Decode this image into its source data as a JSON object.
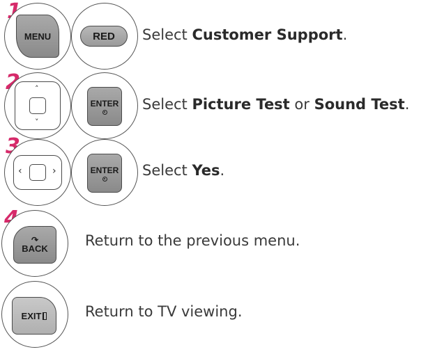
{
  "steps": [
    {
      "number": "1",
      "keys": [
        "MENU",
        "RED"
      ],
      "text_prefix": "Select ",
      "bold1": "Customer Support",
      "suffix": "."
    },
    {
      "number": "2",
      "keys": [
        "nav-up-down",
        "ENTER"
      ],
      "text_prefix": "Select ",
      "bold1": "Picture Test",
      "middle": " or ",
      "bold2": "Sound Test",
      "suffix": "."
    },
    {
      "number": "3",
      "keys": [
        "nav-left-right",
        "ENTER"
      ],
      "text_prefix": "Select ",
      "bold1": "Yes",
      "suffix": "."
    },
    {
      "number": "4",
      "keys": [
        "BACK"
      ],
      "text": "Return to the previous menu."
    },
    {
      "number": "",
      "keys": [
        "EXIT"
      ],
      "text": "Return to TV viewing."
    }
  ],
  "labels": {
    "menu": "MENU",
    "red": "RED",
    "enter": "ENTER",
    "back": "BACK",
    "exit": "EXIT"
  },
  "icons": {
    "up": "˄",
    "down": "˅",
    "left": "‹",
    "right": "›",
    "back_curve": "↷"
  },
  "colors": {
    "step_number": "#d62a6a",
    "key_fill": "#9a9a9a"
  }
}
